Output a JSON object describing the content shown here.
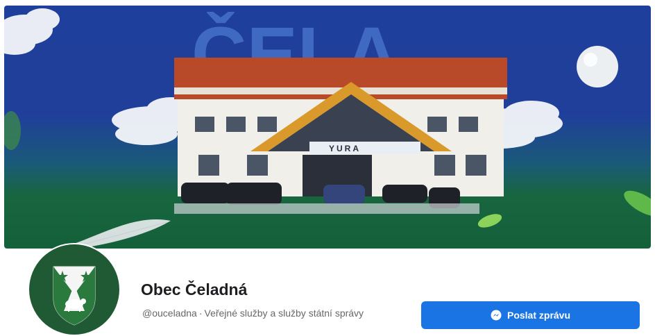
{
  "cover": {
    "banner_text": "ČELA",
    "hotel_sign": "YURA",
    "colors": {
      "sky": "#1f3f9c",
      "grass": "#14603a"
    }
  },
  "profile": {
    "name": "Obec Čeladná",
    "handle": "@ouceladna",
    "separator": "·",
    "category": "Veřejné služby a služby státní správy",
    "avatar_icon": "coat-of-arms-icon"
  },
  "actions": {
    "send_message_label": "Poslat zprávu",
    "send_message_icon": "messenger-icon",
    "accent": "#1b74e4"
  }
}
